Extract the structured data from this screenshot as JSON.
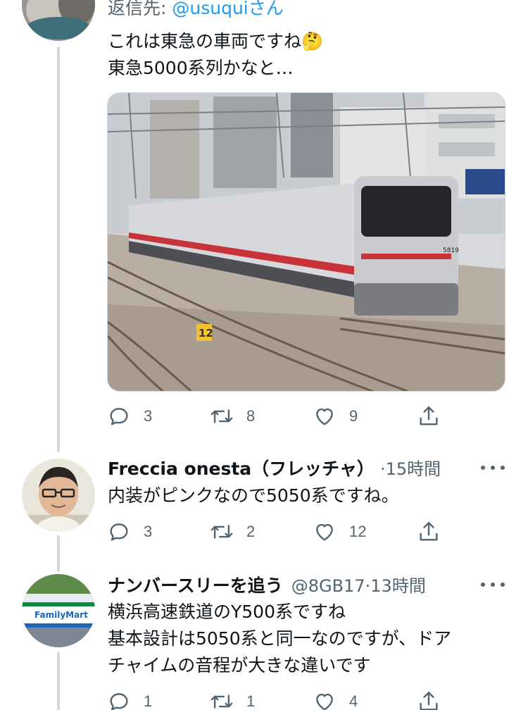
{
  "tweets": [
    {
      "reply_to_prefix": "返信先: ",
      "reply_to_handle": "@usuquiさん",
      "text_lines": [
        "これは東急の車両ですね🤔",
        "東急5000系列かなと…"
      ],
      "media": {
        "type": "photo",
        "car_number": "5819",
        "sign_marker": "12"
      },
      "actions": {
        "replies": "3",
        "retweets": "8",
        "likes": "9"
      }
    },
    {
      "name": "Freccia onesta（フレッチャ）",
      "time": "15時間",
      "text_lines": [
        "内装がピンクなので5050系ですね。"
      ],
      "actions": {
        "replies": "3",
        "retweets": "2",
        "likes": "12"
      }
    },
    {
      "name": "ナンバースリーを追う",
      "handle": "@8GB17",
      "time": "13時間",
      "avatar_store_text": "FamilyMart",
      "text_lines": [
        "横浜高速鉄道のY500系ですね",
        "基本設計は5050系と同一なのですが、ドア",
        "チャイムの音程が大きな違いです"
      ],
      "actions": {
        "replies": "1",
        "retweets": "1",
        "likes": "4"
      }
    }
  ],
  "separator_dot": "·",
  "icons": [
    "reply-icon",
    "retweet-icon",
    "like-icon",
    "share-icon",
    "more-icon"
  ],
  "colors": {
    "text": "#0f1419",
    "secondary": "#536471",
    "link": "#1d9bf0",
    "thread_line": "#cfd9de"
  }
}
